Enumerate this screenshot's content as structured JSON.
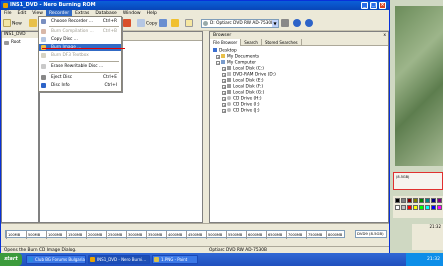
{
  "window": {
    "title": "INS1_DVD - Nero Burning ROM",
    "minimize_icon": "minimize-icon",
    "maximize_icon": "maximize-icon",
    "close_icon": "close-icon"
  },
  "menubar": {
    "items": [
      {
        "label": "File"
      },
      {
        "label": "Edit"
      },
      {
        "label": "View"
      },
      {
        "label": "Recorder"
      },
      {
        "label": "Extras"
      },
      {
        "label": "Database"
      },
      {
        "label": "Window"
      },
      {
        "label": "Help"
      }
    ],
    "active_index": 3
  },
  "toolbar": {
    "new_label": "New",
    "copy_label": "Copy",
    "drive": "D: Optiarc DVD RW AD-7530B"
  },
  "recorder_menu": {
    "items": [
      {
        "label": "Choose Recorder ...",
        "shortcut": "Ctrl+R",
        "disabled": false,
        "icon": "recorder-icon"
      },
      {
        "label": "Burn Compilation ...",
        "shortcut": "Ctrl+B",
        "disabled": true,
        "icon": "burn-icon"
      },
      {
        "label": "Copy Disc ...",
        "shortcut": "",
        "disabled": false,
        "icon": "copy-disc-icon"
      },
      {
        "label": "Burn Image ...",
        "shortcut": "",
        "disabled": false,
        "icon": "burn-image-icon"
      },
      {
        "label": "Burn DF3 Textbox",
        "shortcut": "",
        "disabled": true,
        "icon": "textbox-icon"
      },
      {
        "label": "Erase Rewritable Disc ...",
        "shortcut": "",
        "disabled": false,
        "icon": "erase-icon"
      },
      {
        "label": "Eject Disc",
        "shortcut": "Ctrl+E",
        "disabled": false,
        "icon": "eject-icon"
      },
      {
        "label": "Disc Info",
        "shortcut": "Ctrl+I",
        "disabled": false,
        "icon": "disc-info-icon"
      }
    ],
    "highlighted_index": 3
  },
  "left_pane": {
    "header": "INS1_DVD",
    "root": "Root"
  },
  "browser": {
    "title": "Browser",
    "close": "x",
    "tabs": [
      "File Browser",
      "Search",
      "Stored Searches"
    ],
    "tree": [
      {
        "label": "Desktop",
        "depth": 0,
        "icon": "desktop-icon"
      },
      {
        "label": "My Documents",
        "depth": 1,
        "icon": "folder-icon"
      },
      {
        "label": "My Computer",
        "depth": 1,
        "icon": "computer-icon"
      },
      {
        "label": "Local Disk (C:)",
        "depth": 2,
        "icon": "drive-icon"
      },
      {
        "label": "DVD-RAM Drive (D:)",
        "depth": 2,
        "icon": "dvd-icon"
      },
      {
        "label": "Local Disk (E:)",
        "depth": 2,
        "icon": "drive-icon"
      },
      {
        "label": "Local Disk (F:)",
        "depth": 2,
        "icon": "drive-icon"
      },
      {
        "label": "Local Disk (G:)",
        "depth": 2,
        "icon": "drive-icon"
      },
      {
        "label": "CD Drive (H:)",
        "depth": 2,
        "icon": "cd-icon"
      },
      {
        "label": "CD Drive (I:)",
        "depth": 2,
        "icon": "cd-icon"
      },
      {
        "label": "CD Drive (J:)",
        "depth": 2,
        "icon": "cd-icon"
      }
    ]
  },
  "capacity": {
    "ticks": [
      "100MB",
      "500MB",
      "1000MB",
      "1500MB",
      "2000MB",
      "2500MB",
      "3000MB",
      "3500MB",
      "4000MB",
      "4500MB",
      "5000MB",
      "5500MB",
      "6000MB",
      "6500MB",
      "7000MB",
      "7500MB",
      "8000MB"
    ],
    "select": "DVD9 (8.5GB)"
  },
  "statusbar": {
    "left": "Opens the Burn CD Image Dialog.",
    "right": "Optiarc DVD RW AD-7530B"
  },
  "right_panel": {
    "frame_text": "(8.5GB)"
  },
  "clock": {
    "time": "21:32"
  },
  "taskbar": {
    "start": "start",
    "tasks": [
      {
        "label": "Club BG Forums Bulgaria ..."
      },
      {
        "label": "INS1_DVD - Nero Burni..."
      },
      {
        "label": "1.PNG - Paint"
      }
    ],
    "time": "21:32"
  }
}
